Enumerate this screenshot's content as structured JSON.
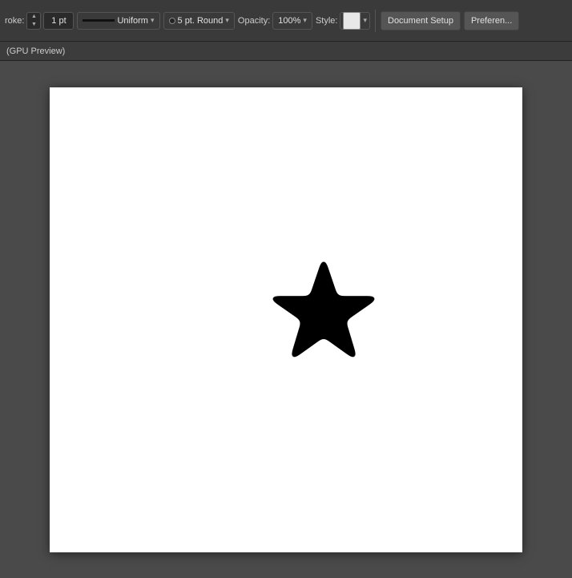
{
  "toolbar": {
    "stroke_label": "roke:",
    "stroke_value": "1 pt",
    "stroke_line": "—",
    "stroke_type": "Uniform",
    "brush_dot": "●",
    "brush_size": "5 pt. Round",
    "opacity_label": "Opacity:",
    "opacity_value": "100%",
    "style_label": "Style:",
    "document_setup": "Document Setup",
    "preferences": "Preferen...",
    "spinner_up": "▲",
    "spinner_down": "▼",
    "dropdown_arrow": "▾"
  },
  "subtoolbar": {
    "label": "(GPU Preview)"
  },
  "canvas": {
    "background": "#ffffff",
    "star_color": "#000000"
  }
}
